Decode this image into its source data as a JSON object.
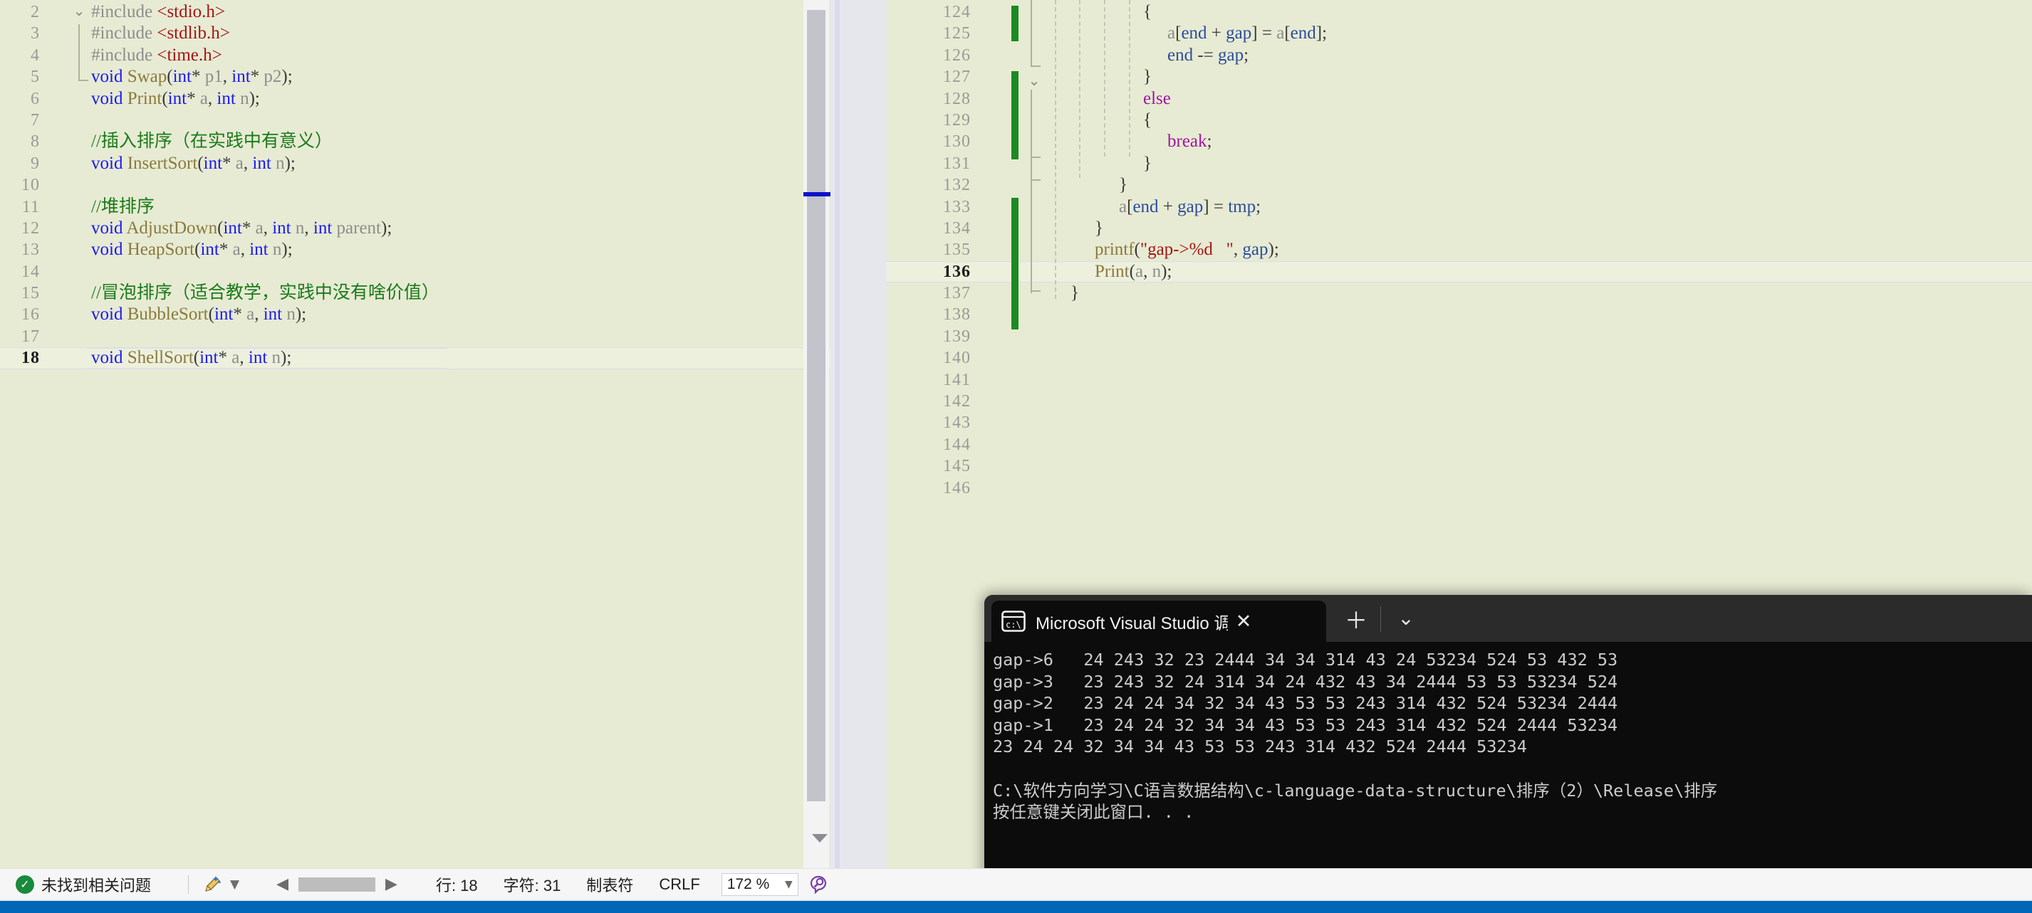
{
  "app": {
    "name": "Visual Studio",
    "theme_bg": "#e7ebd3",
    "accent": "#0067b8"
  },
  "left_editor": {
    "name": "header-declarations-pane",
    "first_line": 2,
    "current_line": 18,
    "lines": [
      {
        "n": 2,
        "tokens": [
          {
            "t": "#include ",
            "c": "pp"
          },
          {
            "t": "<stdio.h>",
            "c": "str"
          }
        ]
      },
      {
        "n": 3,
        "tokens": [
          {
            "t": "#include ",
            "c": "pp"
          },
          {
            "t": "<stdlib.h>",
            "c": "str"
          }
        ]
      },
      {
        "n": 4,
        "tokens": [
          {
            "t": "#include ",
            "c": "pp"
          },
          {
            "t": "<time.h>",
            "c": "str"
          }
        ]
      },
      {
        "n": 5,
        "tokens": [
          {
            "t": "void ",
            "c": "kw"
          },
          {
            "t": "Swap",
            "c": "fn"
          },
          {
            "t": "(",
            "c": "pl"
          },
          {
            "t": "int",
            "c": "kw"
          },
          {
            "t": "* ",
            "c": "pl"
          },
          {
            "t": "p1",
            "c": "id"
          },
          {
            "t": ", ",
            "c": "pl"
          },
          {
            "t": "int",
            "c": "kw"
          },
          {
            "t": "* ",
            "c": "pl"
          },
          {
            "t": "p2",
            "c": "id"
          },
          {
            "t": ");",
            "c": "pl"
          }
        ]
      },
      {
        "n": 6,
        "tokens": [
          {
            "t": "void ",
            "c": "kw"
          },
          {
            "t": "Print",
            "c": "fn"
          },
          {
            "t": "(",
            "c": "pl"
          },
          {
            "t": "int",
            "c": "kw"
          },
          {
            "t": "* ",
            "c": "pl"
          },
          {
            "t": "a",
            "c": "id"
          },
          {
            "t": ", ",
            "c": "pl"
          },
          {
            "t": "int",
            "c": "kw"
          },
          {
            "t": " ",
            "c": "pl"
          },
          {
            "t": "n",
            "c": "id"
          },
          {
            "t": ");",
            "c": "pl"
          }
        ]
      },
      {
        "n": 7,
        "tokens": []
      },
      {
        "n": 8,
        "tokens": [
          {
            "t": "//插入排序（在实践中有意义）",
            "c": "cmt"
          }
        ]
      },
      {
        "n": 9,
        "tokens": [
          {
            "t": "void ",
            "c": "kw"
          },
          {
            "t": "InsertSort",
            "c": "fn"
          },
          {
            "t": "(",
            "c": "pl"
          },
          {
            "t": "int",
            "c": "kw"
          },
          {
            "t": "* ",
            "c": "pl"
          },
          {
            "t": "a",
            "c": "id"
          },
          {
            "t": ", ",
            "c": "pl"
          },
          {
            "t": "int",
            "c": "kw"
          },
          {
            "t": " ",
            "c": "pl"
          },
          {
            "t": "n",
            "c": "id"
          },
          {
            "t": ");",
            "c": "pl"
          }
        ]
      },
      {
        "n": 10,
        "tokens": []
      },
      {
        "n": 11,
        "tokens": [
          {
            "t": "//堆排序",
            "c": "cmt"
          }
        ]
      },
      {
        "n": 12,
        "tokens": [
          {
            "t": "void ",
            "c": "kw"
          },
          {
            "t": "AdjustDown",
            "c": "fn"
          },
          {
            "t": "(",
            "c": "pl"
          },
          {
            "t": "int",
            "c": "kw"
          },
          {
            "t": "* ",
            "c": "pl"
          },
          {
            "t": "a",
            "c": "id"
          },
          {
            "t": ", ",
            "c": "pl"
          },
          {
            "t": "int",
            "c": "kw"
          },
          {
            "t": " ",
            "c": "pl"
          },
          {
            "t": "n",
            "c": "id"
          },
          {
            "t": ", ",
            "c": "pl"
          },
          {
            "t": "int",
            "c": "kw"
          },
          {
            "t": " ",
            "c": "pl"
          },
          {
            "t": "parent",
            "c": "id"
          },
          {
            "t": ");",
            "c": "pl"
          }
        ]
      },
      {
        "n": 13,
        "tokens": [
          {
            "t": "void ",
            "c": "kw"
          },
          {
            "t": "HeapSort",
            "c": "fn"
          },
          {
            "t": "(",
            "c": "pl"
          },
          {
            "t": "int",
            "c": "kw"
          },
          {
            "t": "* ",
            "c": "pl"
          },
          {
            "t": "a",
            "c": "id"
          },
          {
            "t": ", ",
            "c": "pl"
          },
          {
            "t": "int",
            "c": "kw"
          },
          {
            "t": " ",
            "c": "pl"
          },
          {
            "t": "n",
            "c": "id"
          },
          {
            "t": ");",
            "c": "pl"
          }
        ]
      },
      {
        "n": 14,
        "tokens": []
      },
      {
        "n": 15,
        "tokens": [
          {
            "t": "//冒泡排序（适合教学，实践中没有啥价值）",
            "c": "cmt"
          }
        ]
      },
      {
        "n": 16,
        "tokens": [
          {
            "t": "void ",
            "c": "kw"
          },
          {
            "t": "BubbleSort",
            "c": "fn"
          },
          {
            "t": "(",
            "c": "pl"
          },
          {
            "t": "int",
            "c": "kw"
          },
          {
            "t": "* ",
            "c": "pl"
          },
          {
            "t": "a",
            "c": "id"
          },
          {
            "t": ", ",
            "c": "pl"
          },
          {
            "t": "int",
            "c": "kw"
          },
          {
            "t": " ",
            "c": "pl"
          },
          {
            "t": "n",
            "c": "id"
          },
          {
            "t": ");",
            "c": "pl"
          }
        ]
      },
      {
        "n": 17,
        "tokens": []
      },
      {
        "n": 18,
        "tokens": [
          {
            "t": "void ",
            "c": "kw"
          },
          {
            "t": "ShellSort",
            "c": "fn"
          },
          {
            "t": "(",
            "c": "pl"
          },
          {
            "t": "int",
            "c": "kw"
          },
          {
            "t": "* ",
            "c": "pl"
          },
          {
            "t": "a",
            "c": "id"
          },
          {
            "t": ", ",
            "c": "pl"
          },
          {
            "t": "int",
            "c": "kw"
          },
          {
            "t": " ",
            "c": "pl"
          },
          {
            "t": "n",
            "c": "id"
          },
          {
            "t": ");",
            "c": "pl"
          }
        ],
        "highlight": true
      }
    ]
  },
  "right_editor": {
    "name": "shellsort-implementation-pane",
    "first_line": 124,
    "current_line": 136,
    "lines": [
      {
        "n": 124,
        "tokens": [
          {
            "t": "{",
            "c": "pl"
          }
        ],
        "indent": 5
      },
      {
        "n": 125,
        "tokens": [
          {
            "t": "a",
            "c": "id"
          },
          {
            "t": "[",
            "c": "pl"
          },
          {
            "t": "end",
            "c": "var"
          },
          {
            "t": " + ",
            "c": "pl"
          },
          {
            "t": "gap",
            "c": "var"
          },
          {
            "t": "] = ",
            "c": "pl"
          },
          {
            "t": "a",
            "c": "id"
          },
          {
            "t": "[",
            "c": "pl"
          },
          {
            "t": "end",
            "c": "var"
          },
          {
            "t": "];",
            "c": "pl"
          }
        ],
        "indent": 6
      },
      {
        "n": 126,
        "tokens": [
          {
            "t": "end",
            "c": "var"
          },
          {
            "t": " -= ",
            "c": "pl"
          },
          {
            "t": "gap",
            "c": "var"
          },
          {
            "t": ";",
            "c": "pl"
          }
        ],
        "indent": 6
      },
      {
        "n": 127,
        "tokens": [
          {
            "t": "}",
            "c": "pl"
          }
        ],
        "indent": 5
      },
      {
        "n": 128,
        "tokens": [
          {
            "t": "else",
            "c": "kw2"
          }
        ],
        "indent": 5
      },
      {
        "n": 129,
        "tokens": [
          {
            "t": "{",
            "c": "pl"
          }
        ],
        "indent": 5
      },
      {
        "n": 130,
        "tokens": [
          {
            "t": "break",
            "c": "kw2"
          },
          {
            "t": ";",
            "c": "pl"
          }
        ],
        "indent": 6
      },
      {
        "n": 131,
        "tokens": [
          {
            "t": "}",
            "c": "pl"
          }
        ],
        "indent": 5
      },
      {
        "n": 132,
        "tokens": [
          {
            "t": "}",
            "c": "pl"
          }
        ],
        "indent": 4
      },
      {
        "n": 133,
        "tokens": [
          {
            "t": "a",
            "c": "id"
          },
          {
            "t": "[",
            "c": "pl"
          },
          {
            "t": "end",
            "c": "var"
          },
          {
            "t": " + ",
            "c": "pl"
          },
          {
            "t": "gap",
            "c": "var"
          },
          {
            "t": "] = ",
            "c": "pl"
          },
          {
            "t": "tmp",
            "c": "var"
          },
          {
            "t": ";",
            "c": "pl"
          }
        ],
        "indent": 4
      },
      {
        "n": 134,
        "tokens": [
          {
            "t": "}",
            "c": "pl"
          }
        ],
        "indent": 3
      },
      {
        "n": 135,
        "tokens": [
          {
            "t": "printf",
            "c": "fn"
          },
          {
            "t": "(",
            "c": "pl"
          },
          {
            "t": "\"gap->%d   \"",
            "c": "str"
          },
          {
            "t": ", ",
            "c": "pl"
          },
          {
            "t": "gap",
            "c": "var"
          },
          {
            "t": ");",
            "c": "pl"
          }
        ],
        "indent": 3
      },
      {
        "n": 136,
        "tokens": [
          {
            "t": "Print",
            "c": "fn"
          },
          {
            "t": "(",
            "c": "pl"
          },
          {
            "t": "a",
            "c": "id"
          },
          {
            "t": ", ",
            "c": "pl"
          },
          {
            "t": "n",
            "c": "id"
          },
          {
            "t": ");",
            "c": "pl"
          }
        ],
        "indent": 3,
        "highlight": true
      },
      {
        "n": 137,
        "tokens": [
          {
            "t": "}",
            "c": "pl"
          }
        ],
        "indent": 2
      },
      {
        "n": 138,
        "tokens": []
      },
      {
        "n": 139,
        "tokens": []
      },
      {
        "n": 140,
        "tokens": []
      },
      {
        "n": 141,
        "tokens": []
      },
      {
        "n": 142,
        "tokens": []
      },
      {
        "n": 143,
        "tokens": []
      },
      {
        "n": 144,
        "tokens": []
      },
      {
        "n": 145,
        "tokens": []
      },
      {
        "n": 146,
        "tokens": []
      }
    ]
  },
  "console": {
    "tab_label": "Microsoft Visual Studio 调试控",
    "tab_icon": "console-icon",
    "close_label": "✕",
    "new_tab_label": "＋",
    "dropdown_label": "⌄",
    "output_lines": [
      "gap->6   24 243 32 23 2444 34 34 314 43 24 53234 524 53 432 53",
      "gap->3   23 243 32 24 314 34 24 432 43 34 2444 53 53 53234 524",
      "gap->2   23 24 24 34 32 34 43 53 53 243 314 432 524 53234 2444",
      "gap->1   23 24 24 32 34 34 43 53 53 243 314 432 524 2444 53234",
      "23 24 24 32 34 34 43 53 53 243 314 432 524 2444 53234",
      "",
      "C:\\软件方向学习\\C语言数据结构\\c-language-data-structure\\排序（2）\\Release\\排序",
      "按任意键关闭此窗口. . ."
    ]
  },
  "status_bar": {
    "issues_icon": "check-circle-icon",
    "issues_text": "未找到相关问题",
    "broom_icon": "broom-icon",
    "back_arrow": "◀",
    "forward_arrow": "▶",
    "line_label": "行: 18",
    "char_label": "字符: 31",
    "tab_label": "制表符",
    "eol_label": "CRLF",
    "zoom_value": "172 %",
    "feedback_icon": "feedback-icon"
  }
}
